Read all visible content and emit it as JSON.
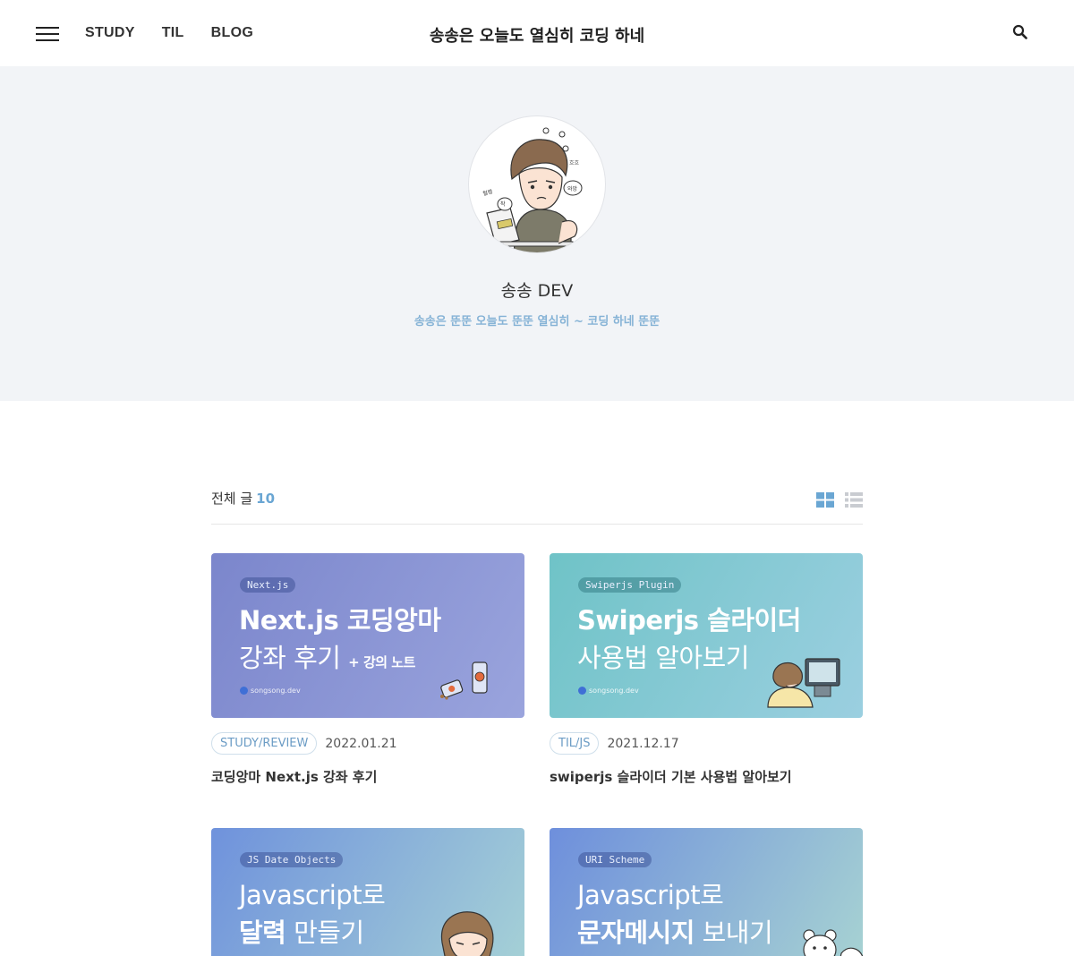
{
  "header": {
    "nav": [
      "STUDY",
      "TIL",
      "BLOG"
    ],
    "title": "송송은 오늘도 열심히 코딩 하네"
  },
  "profile": {
    "name": "송송 DEV",
    "description": "송송은 뚠뚠 오늘도 뚠뚠 열심히 ~ 코딩 하네 뚠뚠",
    "avatar_texts": [
      "헐랭",
      "착",
      "와앙",
      "흐흐",
      "NOTE"
    ]
  },
  "list": {
    "count_label": "전체 글",
    "count": "10"
  },
  "posts": [
    {
      "thumb_tag": "Next.js",
      "thumb_line1": "Next.js 코딩앙마",
      "thumb_line2": "강좌 후기",
      "thumb_small": "+ 강의 노트",
      "thumb_brand": "songsong.dev",
      "category": "STUDY/REVIEW",
      "date": "2022.01.21",
      "title": "코딩앙마 Next.js 강좌 후기"
    },
    {
      "thumb_tag": "Swiperjs Plugin",
      "thumb_line1": "Swiperjs 슬라이더",
      "thumb_line2": "사용법 알아보기",
      "thumb_brand": "songsong.dev",
      "category": "TIL/JS",
      "date": "2021.12.17",
      "title": "swiperjs 슬라이더 기본 사용법 알아보기"
    },
    {
      "thumb_tag": "JS Date Objects",
      "thumb_line1": "Javascript로",
      "thumb_line2_bold": "달력",
      "thumb_line2": "만들기"
    },
    {
      "thumb_tag": "URI Scheme",
      "thumb_line1": "Javascript로",
      "thumb_line2_bold": "문자메시지",
      "thumb_line2": "보내기"
    }
  ],
  "colors": {
    "accent": "#6aa6d3",
    "hero_bg": "#f2f4f7",
    "thumb_next": "#8693d0",
    "thumb_swiper": "#7ec7cd",
    "thumb_date": "#7fa6dc",
    "thumb_uri": "#8198dc"
  },
  "icons": {
    "menu": "hamburger-menu-icon",
    "search": "search-icon",
    "grid_view": "grid-view-icon",
    "list_view": "list-view-icon"
  }
}
